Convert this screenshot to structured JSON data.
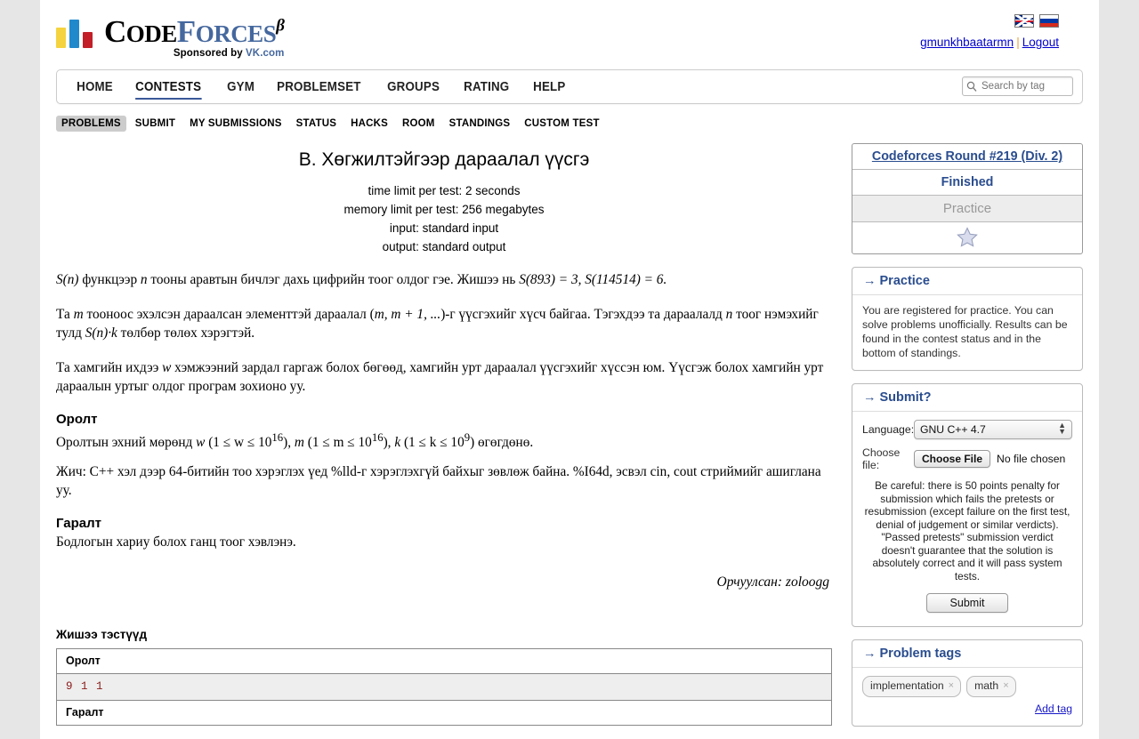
{
  "header": {
    "logo": {
      "code": "C",
      "code_rest": "ODE",
      "forces": "F",
      "forces_rest": "ORCES",
      "beta": "β",
      "sponsor_prefix": "Sponsored by ",
      "sponsor_name": "VK.com"
    },
    "flags": [
      "uk-flag-icon",
      "russia-flag-icon"
    ],
    "user": "gmunkhbaatarmn",
    "separator": "|",
    "logout": "Logout"
  },
  "menu": {
    "items": [
      {
        "label": "HOME",
        "active": false
      },
      {
        "label": "CONTESTS",
        "active": true
      },
      {
        "label": "GYM",
        "active": false
      },
      {
        "label": "PROBLEMSET",
        "active": false
      },
      {
        "label": "GROUPS",
        "active": false
      },
      {
        "label": "RATING",
        "active": false
      },
      {
        "label": "HELP",
        "active": false
      }
    ],
    "search_placeholder": "Search by tag",
    "search_value": ""
  },
  "subtabs": [
    {
      "label": "PROBLEMS",
      "active": true
    },
    {
      "label": "SUBMIT",
      "active": false
    },
    {
      "label": "MY SUBMISSIONS",
      "active": false
    },
    {
      "label": "STATUS",
      "active": false
    },
    {
      "label": "HACKS",
      "active": false
    },
    {
      "label": "ROOM",
      "active": false
    },
    {
      "label": "STANDINGS",
      "active": false
    },
    {
      "label": "CUSTOM TEST",
      "active": false
    }
  ],
  "problem": {
    "title": "B. Хөгжилтэйгээр дараалал үүсгэ",
    "time_limit": "time limit per test: 2 seconds",
    "memory_limit": "memory limit per test: 256 megabytes",
    "input_spec": "input: standard input",
    "output_spec": "output: standard output",
    "p1_a": "S(n)",
    "p1_b": " функцээр ",
    "p1_c": "n",
    "p1_d": " тооны аравтын бичлэг дахь цифрийн тоог олдог гэе. Жишээ нь ",
    "p1_e": "S(893) = 3, S(114514) = 6.",
    "p2_a": "Та ",
    "p2_b": "m",
    "p2_c": " тооноос эхэлсэн дараалсан элементтэй дараалал (",
    "p2_d": "m, m + 1, ...",
    "p2_e": ")-г үүсгэхийг хүсч байгаа. Тэгэхдээ та дараалалд ",
    "p2_f": "n",
    "p2_g": " тоог нэмэхийг тулд ",
    "p2_h": "S(n)·k",
    "p2_i": " төлбөр төлөх хэрэгтэй.",
    "p3_a": "Та хамгийн ихдээ ",
    "p3_b": "w",
    "p3_c": " хэмжээний зардал гаргаж болох бөгөөд, хамгийн урт дараалал үүсгэхийг хүссэн юм. Үүсгэж болох хамгийн урт дараалын уртыг олдог програм зохионо уу.",
    "input_heading": "Оролт",
    "input_text_a": "Оролтын эхний мөрөнд ",
    "input_w": "w",
    "input_w_cond": "(1 ≤ w ≤ 10",
    "input_w_exp": "16",
    "input_w_end": "), ",
    "input_m": "m",
    "input_m_cond": "(1 ≤ m ≤ 10",
    "input_m_exp": "16",
    "input_m_end": "), ",
    "input_k": "k",
    "input_k_cond": "(1 ≤ k ≤ 10",
    "input_k_exp": "9",
    "input_k_end": ") өгөгдөнө.",
    "note_text": "Жич: C++ хэл дээр 64-битийн тоо хэрэглэх үед %lld-г хэрэглэхгүй байхыг зөвлөж байна. %I64d, эсвэл cin, cout стриймийг ашиглана уу.",
    "output_heading": "Гаралт",
    "output_text": "Бодлогын хариу болох ганц тоог хэвлэнэ.",
    "translator": "Орчуулсан: zoloogg",
    "samples_heading": "Жишээ тэстүүд",
    "sample_input_label": "Оролт",
    "sample_input_value": "9 1 1",
    "sample_output_label": "Гаралт"
  },
  "sidebar": {
    "contest": {
      "name": "Codeforces Round #219 (Div. 2)",
      "status": "Finished",
      "phase": "Practice",
      "star_icon": "star-icon"
    },
    "practice": {
      "arrow": "→",
      "title": "Practice",
      "text": "You are registered for practice. You can solve problems unofficially. Results can be found in the contest status and in the bottom of standings."
    },
    "submit": {
      "arrow": "→",
      "title": "Submit?",
      "language_label": "Language:",
      "language_value": "GNU C++ 4.7",
      "choose_file_label": "Choose file:",
      "choose_file_button": "Choose File",
      "no_file_text": "No file chosen",
      "warning": "Be careful: there is 50 points penalty for submission which fails the pretests or resubmission (except failure on the first test, denial of judgement or similar verdicts). \"Passed pretests\" submission verdict doesn't guarantee that the solution is absolutely correct and it will pass system tests.",
      "submit_button": "Submit"
    },
    "tags": {
      "arrow": "→",
      "title": "Problem tags",
      "items": [
        {
          "label": "implementation",
          "remove": "×"
        },
        {
          "label": "math",
          "remove": "×"
        }
      ],
      "add_tag": "Add tag"
    }
  },
  "colors": {
    "accent_blue": "#2a4d8f",
    "link_blue": "#0000cd",
    "logo_yellow": "#f5d33f",
    "logo_blue": "#2089cc",
    "logo_red": "#c21f28",
    "sample_text": "#8b1a1a"
  }
}
